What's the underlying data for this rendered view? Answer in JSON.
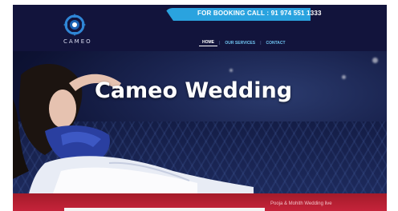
{
  "header": {
    "booking": "FOR BOOKING CALL : 91 974 551 1333",
    "brand": "CAMEO"
  },
  "nav": {
    "items": [
      {
        "label": "HOME",
        "active": true
      },
      {
        "label": "OUR SERVICES",
        "active": false
      },
      {
        "label": "CONTACT",
        "active": false
      }
    ]
  },
  "hero": {
    "title": "Cameo Wedding"
  },
  "footer": {
    "caption": "Pooja & Mohith Wedding live"
  },
  "colors": {
    "header_bg": "#12143c",
    "booking_bar": "#2aa3df",
    "nav_link": "#6fc3f0",
    "band_red": "#c5233a"
  },
  "icons": {
    "logo": "cameo-logo-icon"
  }
}
